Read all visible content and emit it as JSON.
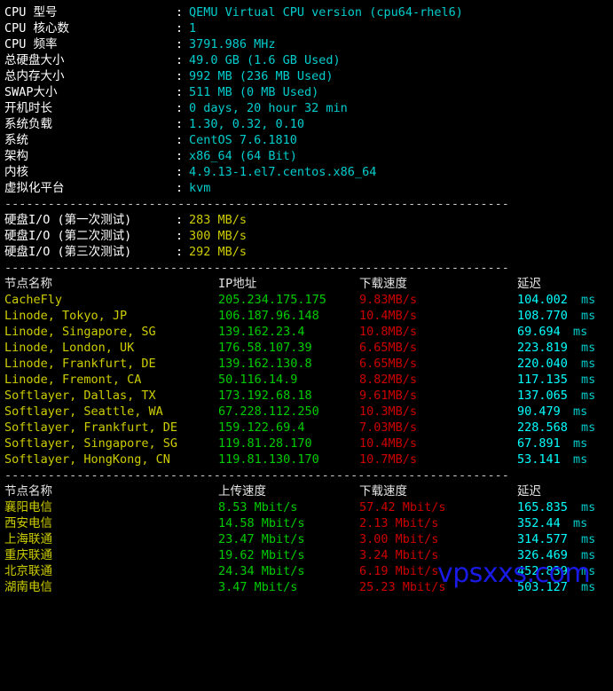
{
  "terminal": {
    "background": "#000000",
    "separator": "----------------------------------------------------------------------",
    "colon": ":"
  },
  "sysinfo": {
    "rows": [
      {
        "label": "CPU 型号",
        "value": "QEMU Virtual CPU version (cpu64-rhel6)"
      },
      {
        "label": "CPU 核心数",
        "value": "1"
      },
      {
        "label": "CPU 频率",
        "value": "3791.986 MHz"
      },
      {
        "label": "总硬盘大小",
        "value": "49.0 GB (1.6 GB Used)"
      },
      {
        "label": "总内存大小",
        "value": "992 MB (236 MB Used)"
      },
      {
        "label": "SWAP大小",
        "value": "511 MB (0 MB Used)"
      },
      {
        "label": "开机时长",
        "value": "0 days, 20 hour 32 min"
      },
      {
        "label": "系统负载",
        "value": "1.30, 0.32, 0.10"
      },
      {
        "label": "系统",
        "value": "CentOS 7.6.1810"
      },
      {
        "label": "架构",
        "value": "x86_64 (64 Bit)"
      },
      {
        "label": "内核",
        "value": "4.9.13-1.el7.centos.x86_64"
      },
      {
        "label": "虚拟化平台",
        "value": "kvm"
      }
    ]
  },
  "diskio": {
    "rows": [
      {
        "label": "硬盘I/O (第一次测试)",
        "value": "283 MB/s"
      },
      {
        "label": "硬盘I/O (第二次测试)",
        "value": "300 MB/s"
      },
      {
        "label": "硬盘I/O (第三次测试)",
        "value": "292 MB/s"
      }
    ]
  },
  "speedtest_intl": {
    "headers": {
      "name": "节点名称",
      "ip": "IP地址",
      "download": "下载速度",
      "latency": "延迟"
    },
    "rows": [
      {
        "name": "CacheFly",
        "ip": "205.234.175.175",
        "download": "9.83MB/s",
        "latency": "104.002",
        "unit": "ms"
      },
      {
        "name": "Linode, Tokyo, JP",
        "ip": "106.187.96.148",
        "download": "10.4MB/s",
        "latency": "108.770",
        "unit": "ms"
      },
      {
        "name": "Linode, Singapore, SG",
        "ip": "139.162.23.4",
        "download": "10.8MB/s",
        "latency": "69.694",
        "unit": "ms"
      },
      {
        "name": "Linode, London, UK",
        "ip": "176.58.107.39",
        "download": "6.65MB/s",
        "latency": "223.819",
        "unit": "ms"
      },
      {
        "name": "Linode, Frankfurt, DE",
        "ip": "139.162.130.8",
        "download": "6.65MB/s",
        "latency": "220.040",
        "unit": "ms"
      },
      {
        "name": "Linode, Fremont, CA",
        "ip": "50.116.14.9",
        "download": "8.82MB/s",
        "latency": "117.135",
        "unit": "ms"
      },
      {
        "name": "Softlayer, Dallas, TX",
        "ip": "173.192.68.18",
        "download": "9.61MB/s",
        "latency": "137.065",
        "unit": "ms"
      },
      {
        "name": "Softlayer, Seattle, WA",
        "ip": "67.228.112.250",
        "download": "10.3MB/s",
        "latency": "90.479",
        "unit": "ms"
      },
      {
        "name": "Softlayer, Frankfurt, DE",
        "ip": "159.122.69.4",
        "download": "7.03MB/s",
        "latency": "228.568",
        "unit": "ms"
      },
      {
        "name": "Softlayer, Singapore, SG",
        "ip": "119.81.28.170",
        "download": "10.4MB/s",
        "latency": "67.891",
        "unit": "ms"
      },
      {
        "name": "Softlayer, HongKong, CN",
        "ip": "119.81.130.170",
        "download": "10.7MB/s",
        "latency": "53.141",
        "unit": "ms"
      }
    ]
  },
  "speedtest_cn": {
    "headers": {
      "name": "节点名称",
      "upload": "上传速度",
      "download": "下载速度",
      "latency": "延迟"
    },
    "rows": [
      {
        "name": "襄阳电信",
        "upload": "8.53 Mbit/s",
        "download": "57.42 Mbit/s",
        "latency": "165.835",
        "unit": "ms"
      },
      {
        "name": "西安电信",
        "upload": "14.58 Mbit/s",
        "download": "2.13 Mbit/s",
        "latency": "352.44",
        "unit": "ms"
      },
      {
        "name": "上海联通",
        "upload": "23.47 Mbit/s",
        "download": "3.00 Mbit/s",
        "latency": "314.577",
        "unit": "ms"
      },
      {
        "name": "重庆联通",
        "upload": "19.62 Mbit/s",
        "download": "3.24 Mbit/s",
        "latency": "326.469",
        "unit": "ms"
      },
      {
        "name": "北京联通",
        "upload": "24.34 Mbit/s",
        "download": "6.19 Mbit/s",
        "latency": "452.839",
        "unit": "ms"
      },
      {
        "name": "湖南电信",
        "upload": "3.47 Mbit/s",
        "download": "25.23 Mbit/s",
        "latency": "503.127",
        "unit": "ms"
      }
    ]
  },
  "watermark": {
    "text": "vpsxxs.com",
    "color": "#1a1ae6"
  }
}
